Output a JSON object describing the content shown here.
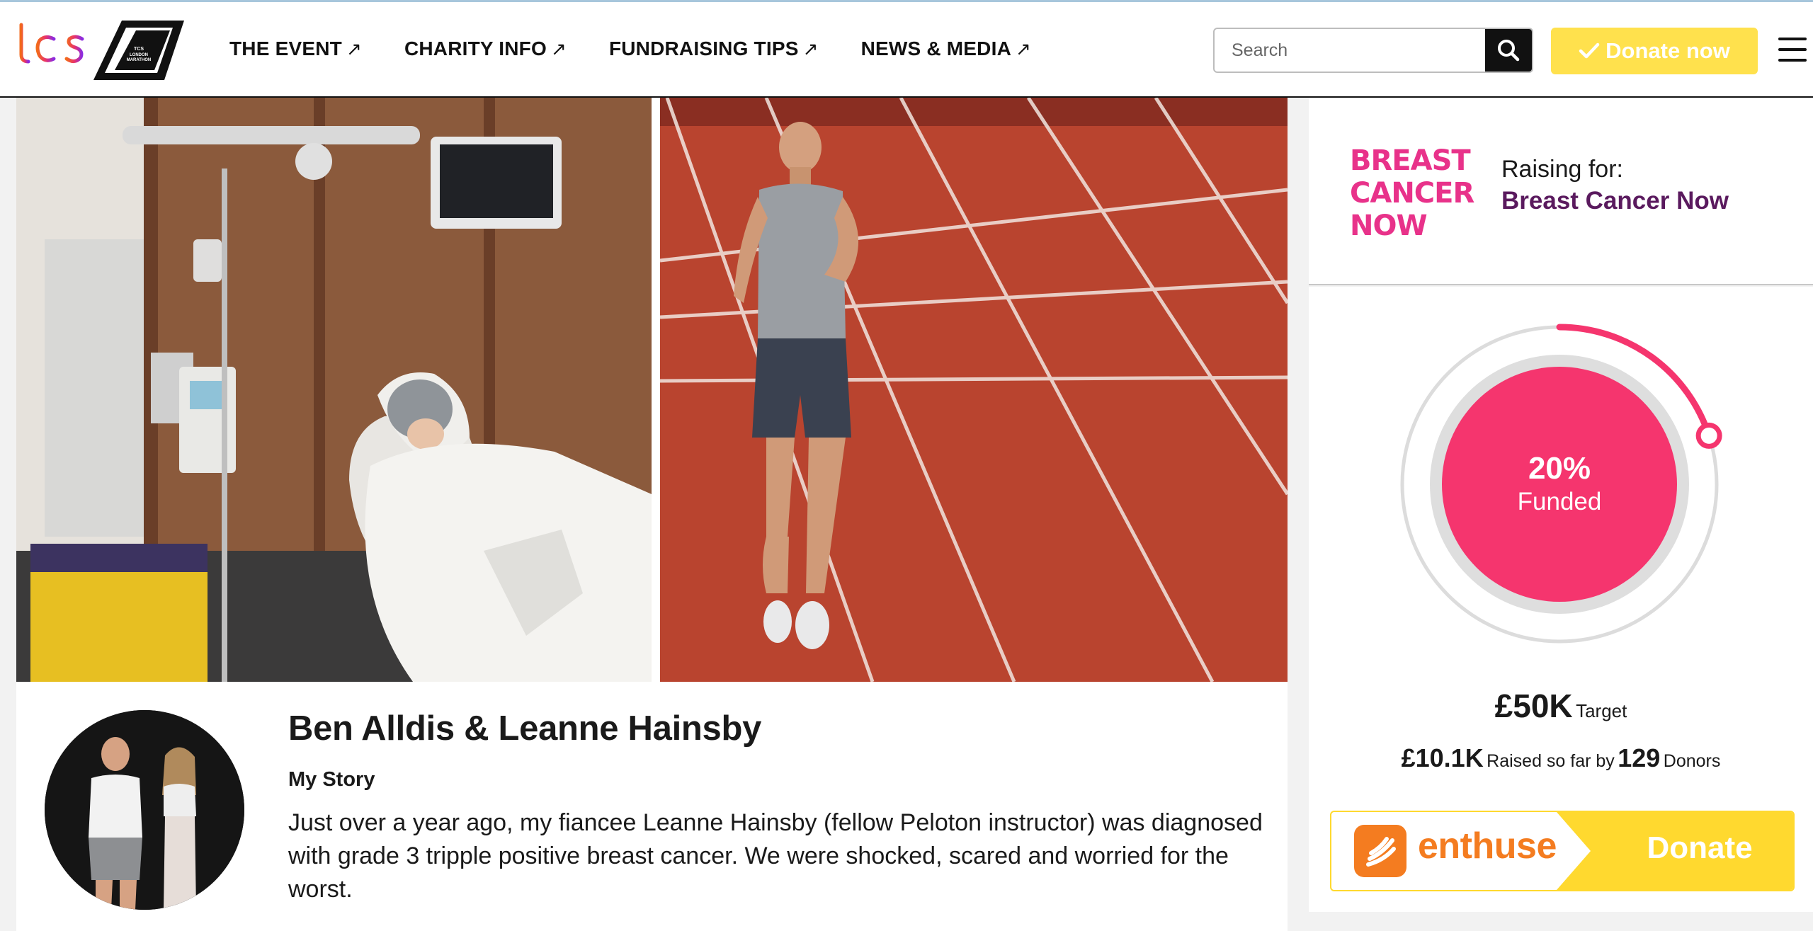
{
  "header": {
    "nav": [
      {
        "label": "THE EVENT",
        "arrow": "↗"
      },
      {
        "label": "CHARITY INFO",
        "arrow": "↗"
      },
      {
        "label": "FUNDRAISING TIPS",
        "arrow": "↗"
      },
      {
        "label": "NEWS & MEDIA",
        "arrow": "↗"
      }
    ],
    "search_placeholder": "Search",
    "donate_now_label": "Donate now",
    "logo_tcs_text": "tcs",
    "logo_lm_text": "TCS LONDON MARATHON"
  },
  "fundraiser": {
    "name": "Ben Alldis & Leanne Hainsby",
    "story_heading": "My Story",
    "story_text": "Just over a year ago, my fiancee Leanne Hainsby (fellow Peloton instructor) was diagnosed with grade 3 tripple positive breast cancer. We were shocked, scared and worried for the worst."
  },
  "charity": {
    "raising_label": "Raising for:",
    "name": "Breast Cancer Now",
    "logo_text": "BREAST CANCER NOW"
  },
  "stats": {
    "percent_funded": 20,
    "percent_label": "20%",
    "funded_label": "Funded",
    "target_amount": "£50K",
    "target_label": "Target",
    "raised_amount": "£10.1K",
    "raised_label": "Raised so far by",
    "donors_count": "129",
    "donors_label": "Donors"
  },
  "donate_button": {
    "brand": "enthuse",
    "label": "Donate"
  },
  "colors": {
    "accent_yellow": "#ffe14d",
    "charity_pink": "#f5356e",
    "charity_purple": "#5a1a5e",
    "enthuse_orange": "#f47c20"
  }
}
